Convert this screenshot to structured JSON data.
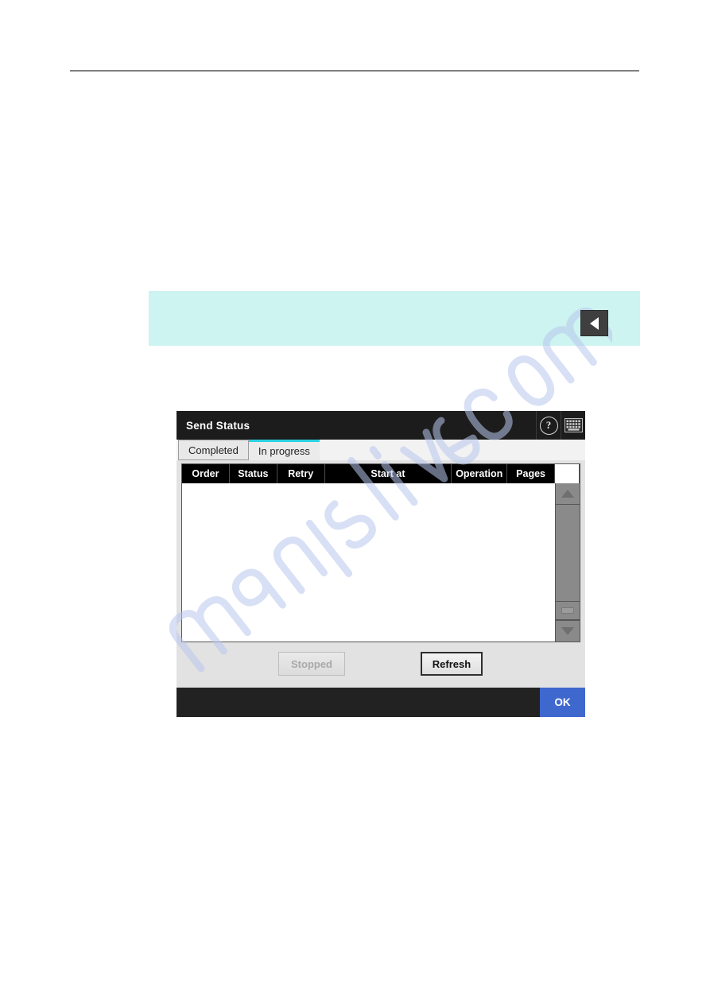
{
  "page": {
    "rule_visible": true,
    "watermark_text": "manualshive.com"
  },
  "callout": {
    "background_color": "#cdf4f0",
    "back_button": {
      "icon": "triangle-left-icon",
      "label": ""
    }
  },
  "dialog": {
    "title": "Send Status",
    "title_icons": [
      {
        "name": "help-icon",
        "glyph": "?"
      },
      {
        "name": "keyboard-icon",
        "glyph": "keyboard"
      }
    ],
    "tabs": [
      {
        "label": "Completed",
        "active": false
      },
      {
        "label": "In progress",
        "active": true
      }
    ],
    "active_tab_accent": "#2ad2e0",
    "table": {
      "columns": [
        "Order",
        "Status",
        "Retry",
        "Start at",
        "Operation",
        "Pages"
      ],
      "rows": []
    },
    "scrollbar": {
      "up_arrow": "triangle-up-icon",
      "grip": "grip-handle-icon",
      "down_arrow": "triangle-down-icon"
    },
    "buttons": {
      "stopped": {
        "label": "Stopped",
        "enabled": false
      },
      "refresh": {
        "label": "Refresh",
        "enabled": true
      }
    },
    "footer": {
      "ok": {
        "label": "OK",
        "color": "#3f68cf"
      }
    }
  }
}
